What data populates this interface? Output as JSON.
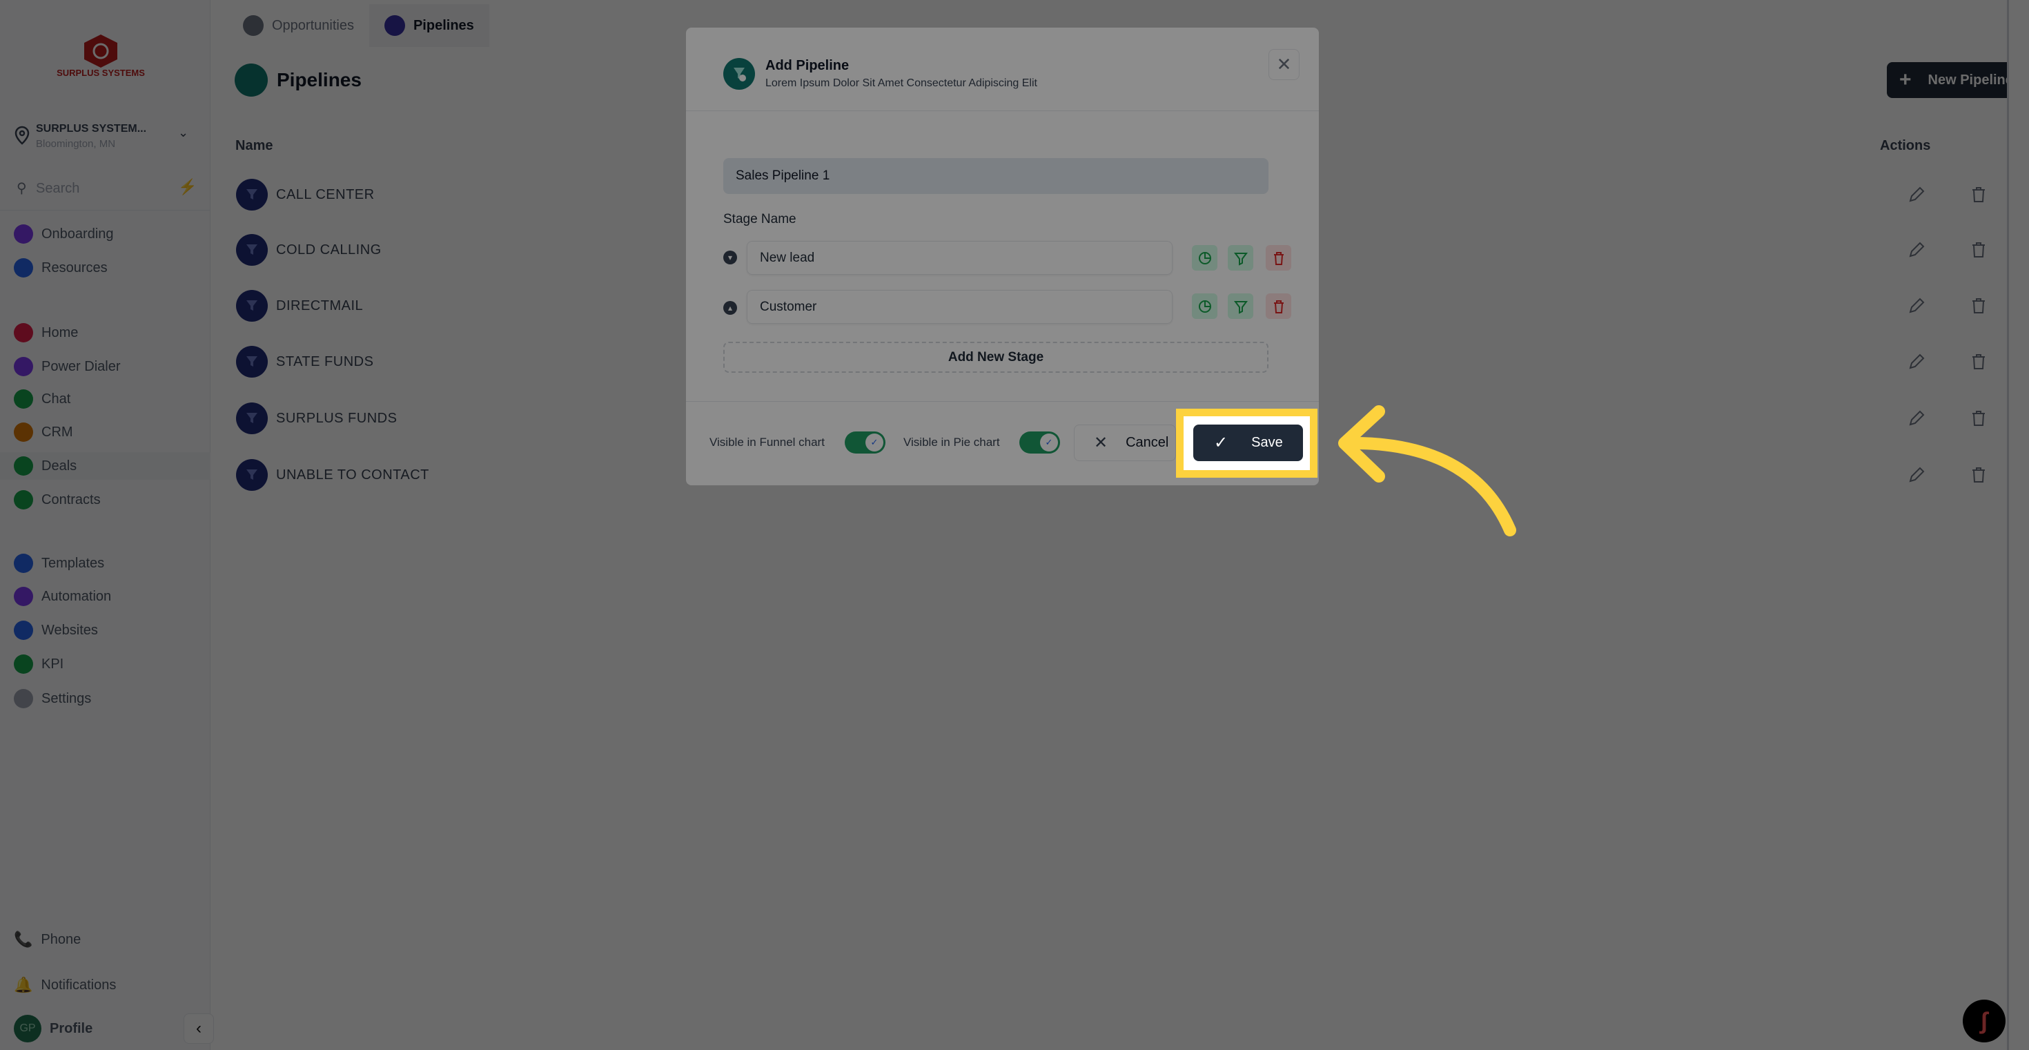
{
  "tabs": [
    {
      "label": "Opportunities",
      "active": false
    },
    {
      "label": "Pipelines",
      "active": true
    }
  ],
  "sidebar": {
    "brand": "SURPLUS SYSTEMS",
    "location_name": "SURPLUS SYSTEM...",
    "location_city": "Bloomington, MN",
    "search_placeholder": "Search",
    "items": [
      {
        "label": "Onboarding",
        "color": "#7c3aed"
      },
      {
        "label": "Resources",
        "color": "#2563eb"
      },
      {
        "label": "Home",
        "color": "#e11d48"
      },
      {
        "label": "Power Dialer",
        "color": "#7c3aed"
      },
      {
        "label": "Chat",
        "color": "#16a34a"
      },
      {
        "label": "CRM",
        "color": "#d97706"
      },
      {
        "label": "Deals",
        "color": "#16a34a"
      },
      {
        "label": "Contracts",
        "color": "#16a34a"
      },
      {
        "label": "Templates",
        "color": "#2563eb"
      },
      {
        "label": "Automation",
        "color": "#7c3aed"
      },
      {
        "label": "Websites",
        "color": "#2563eb"
      },
      {
        "label": "KPI",
        "color": "#16a34a"
      },
      {
        "label": "Settings",
        "color": "#9ca3af"
      }
    ],
    "phone": "Phone",
    "notifications": "Notifications",
    "profile": "Profile",
    "profile_initials": "GP"
  },
  "main": {
    "title": "Pipelines",
    "new_button": "New Pipeline",
    "col_name": "Name",
    "col_actions": "Actions",
    "rows": [
      "CALL CENTER",
      "COLD CALLING",
      "DIRECTMAIL",
      "STATE FUNDS",
      "SURPLUS FUNDS",
      "UNABLE TO CONTACT"
    ]
  },
  "modal": {
    "title": "Add Pipeline",
    "subtitle": "Lorem Ipsum Dolor Sit Amet Consectetur Adipiscing Elit",
    "pipeline_name": "Sales Pipeline 1",
    "stage_label": "Stage Name",
    "stages": [
      "New lead",
      "Customer"
    ],
    "add_stage": "Add New Stage",
    "toggles": [
      {
        "label": "Visible in Funnel chart",
        "on": true
      },
      {
        "label": "Visible in Pie chart",
        "on": true
      }
    ],
    "cancel": "Cancel",
    "save": "Save"
  },
  "colors": {
    "accent": "#1f2937",
    "highlight": "#fdd23e",
    "toggle": "#1f9d63",
    "teal": "#0f766e"
  }
}
